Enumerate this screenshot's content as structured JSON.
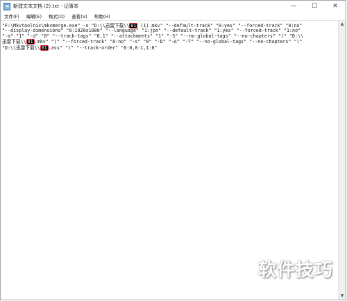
{
  "window": {
    "title": "新建文本文档 (2).txt - 记事本",
    "controls": {
      "minimize": "—",
      "maximize": "☐",
      "close": "✕"
    },
    "app_icon": "notepad-icon"
  },
  "menu": [
    "文件(F)",
    "编辑(E)",
    "格式(O)",
    "查看(V)",
    "帮助(H)"
  ],
  "lines": [
    {
      "parts": [
        {
          "t": "\"F:\\Mkvtoolnix\\mkvmerge.exe\" -o \"D:\\\\迅雷下载\\\\"
        },
        {
          "t": "01",
          "hl": true
        },
        {
          "t": " (1).mkv\" \"--default-track\" \"0:yes\" \"--forced-track\" \"0:no\""
        }
      ]
    },
    {
      "parts": [
        {
          "t": "\"--display-dimensions\" \"0:1920x1080\" \"--language\" \"1:jpn\" \"--default-track\" \"1:yes\" \"--forced-track\" \"1:no\""
        }
      ]
    },
    {
      "parts": [
        {
          "t": "\"-a\" \"1\" \"-d\" \"0\" \"--track-tags\" \"0,1\" \"--attachments\" \"1\" \"-S\" \"--no-global-tags\" \"--no-chapters\" \"(\" \"D:\\\\"
        }
      ]
    },
    {
      "parts": [
        {
          "t": "迅雷下载\\\\"
        },
        {
          "t": "01",
          "hl": true
        },
        {
          "t": ".mkv\" \")\" \"--forced-track\" \"0:no\" \"-s\" \"0\" \"-D\" \"-A\" \"-T\" \"--no-global-tags\" \"--no-chapters\" \"(\""
        }
      ]
    },
    {
      "parts": [
        {
          "t": "\"D:\\\\迅雷下载\\\\"
        },
        {
          "t": "01",
          "hl": true
        },
        {
          "t": ".ass\" \")\" \"--track-order\" \"0:0,0:1,1:0\""
        }
      ]
    }
  ],
  "watermark": "软件技巧",
  "scrollbar": {
    "up": "▲",
    "down": "▼"
  }
}
